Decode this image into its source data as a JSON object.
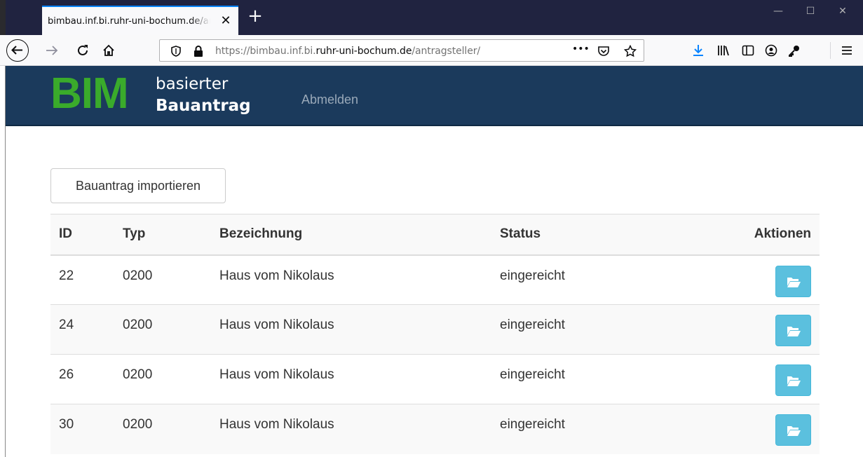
{
  "browser": {
    "tab_title": "bimbau.inf.bi.ruhr-uni-bochum.de/antragsteller/",
    "tab_close": "✕",
    "new_tab": "+",
    "url_prefix": "https://bimbau.inf.bi.",
    "url_domain": "ruhr-uni-bochum.de",
    "url_path": "/antragsteller/",
    "more_label": "•••",
    "icons": [
      "back-icon",
      "forward-icon",
      "reload-icon",
      "home-icon",
      "shield-icon",
      "lock-icon",
      "more-icon",
      "pocket-icon",
      "star-icon",
      "download-icon",
      "library-icon",
      "sidebar-icon",
      "account-icon",
      "passwords-icon",
      "menu-icon"
    ]
  },
  "site": {
    "logo_big": "BIM",
    "logo_line1": "basierter",
    "logo_line2": "Bauantrag",
    "nav_logout": "Abmelden"
  },
  "main": {
    "import_button": "Bauantrag importieren",
    "table": {
      "headers": {
        "id": "ID",
        "typ": "Typ",
        "bez": "Bezeichnung",
        "status": "Status",
        "aktionen": "Aktionen"
      },
      "rows": [
        {
          "id": "22",
          "typ": "0200",
          "bez": "Haus vom Nikolaus",
          "status": "eingereicht"
        },
        {
          "id": "24",
          "typ": "0200",
          "bez": "Haus vom Nikolaus",
          "status": "eingereicht"
        },
        {
          "id": "26",
          "typ": "0200",
          "bez": "Haus vom Nikolaus",
          "status": "eingereicht"
        },
        {
          "id": "30",
          "typ": "0200",
          "bez": "Haus vom Nikolaus",
          "status": "eingereicht"
        }
      ],
      "action_icon": "folder-open-icon"
    }
  },
  "colors": {
    "header_bg": "#1b3a5c",
    "logo_green": "#3aab2b",
    "action_button": "#5bc0de",
    "tabbar_bg": "#202340"
  }
}
